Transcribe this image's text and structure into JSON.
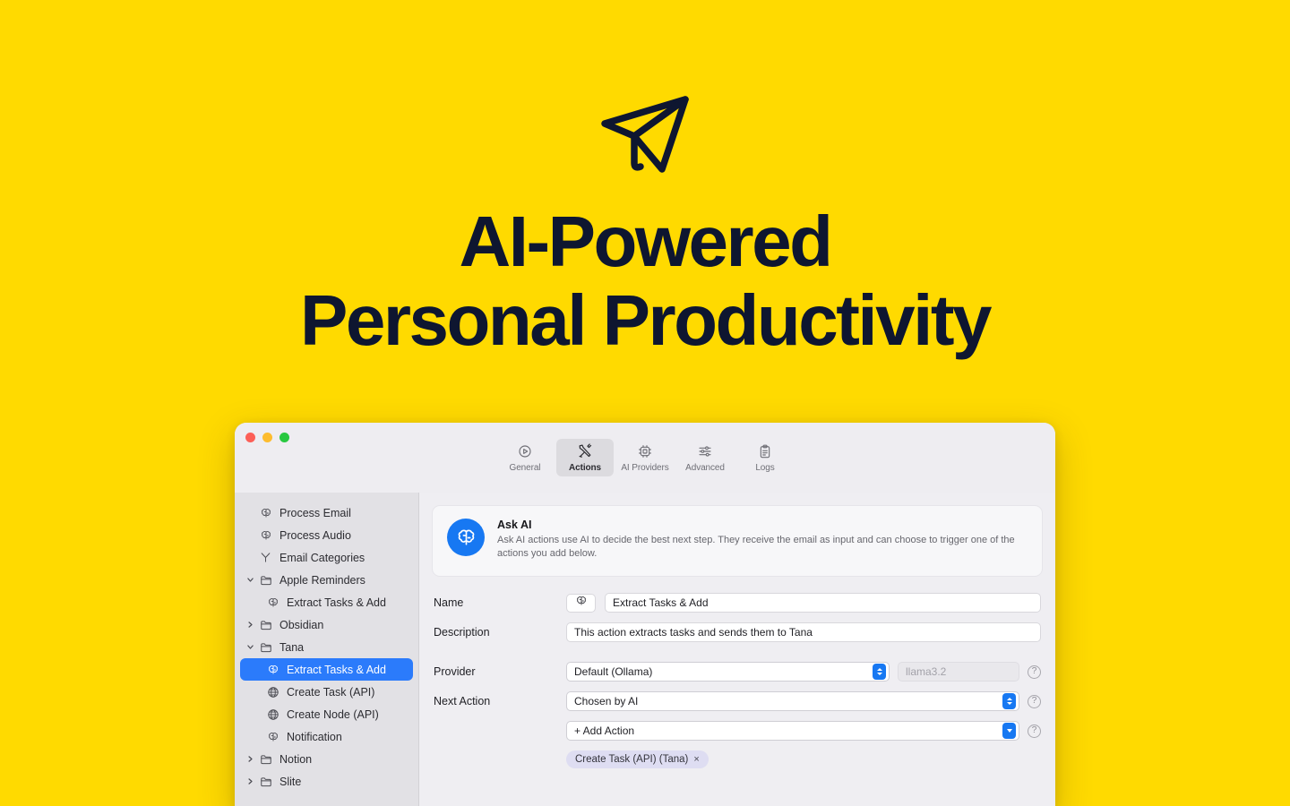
{
  "hero": {
    "logo_icon": "paper-plane-send-icon",
    "title_line1": "AI-Powered",
    "title_line2": "Personal Productivity",
    "background_color": "#FFDA00",
    "text_color": "#0E1630"
  },
  "window": {
    "traffic_lights": [
      "close",
      "minimize",
      "zoom"
    ],
    "accent_color": "#1778F2",
    "selection_color": "#2B7BFB",
    "tabs": [
      {
        "label": "General",
        "icon": "play-circle-icon",
        "active": false
      },
      {
        "label": "Actions",
        "icon": "tools-icon",
        "active": true
      },
      {
        "label": "AI Providers",
        "icon": "chip-icon",
        "active": false
      },
      {
        "label": "Advanced",
        "icon": "sliders-icon",
        "active": false
      },
      {
        "label": "Logs",
        "icon": "clipboard-icon",
        "active": false
      }
    ]
  },
  "sidebar": {
    "items": [
      {
        "label": "Process Email",
        "icon": "brain-icon",
        "indent": 0,
        "chevron": "none",
        "selected": false
      },
      {
        "label": "Process Audio",
        "icon": "brain-icon",
        "indent": 0,
        "chevron": "none",
        "selected": false
      },
      {
        "label": "Email Categories",
        "icon": "branch-icon",
        "indent": 0,
        "chevron": "none",
        "selected": false
      },
      {
        "label": "Apple Reminders",
        "icon": "folder-icon",
        "indent": 0,
        "chevron": "expanded",
        "selected": false
      },
      {
        "label": "Extract Tasks & Add",
        "icon": "brain-icon",
        "indent": 1,
        "chevron": "none",
        "selected": false
      },
      {
        "label": "Obsidian",
        "icon": "folder-icon",
        "indent": 0,
        "chevron": "collapsed",
        "selected": false
      },
      {
        "label": "Tana",
        "icon": "folder-icon",
        "indent": 0,
        "chevron": "expanded",
        "selected": false
      },
      {
        "label": "Extract Tasks & Add",
        "icon": "brain-icon",
        "indent": 1,
        "chevron": "none",
        "selected": true
      },
      {
        "label": "Create Task (API)",
        "icon": "globe-icon",
        "indent": 1,
        "chevron": "none",
        "selected": false
      },
      {
        "label": "Create Node (API)",
        "icon": "globe-icon",
        "indent": 1,
        "chevron": "none",
        "selected": false
      },
      {
        "label": "Notification",
        "icon": "brain-icon",
        "indent": 1,
        "chevron": "none",
        "selected": false
      },
      {
        "label": "Notion",
        "icon": "folder-icon",
        "indent": 0,
        "chevron": "collapsed",
        "selected": false
      },
      {
        "label": "Slite",
        "icon": "folder-icon",
        "indent": 0,
        "chevron": "collapsed",
        "selected": false
      }
    ]
  },
  "main": {
    "info": {
      "icon": "brain-icon",
      "title": "Ask AI",
      "description": "Ask AI actions use AI to decide the best next step. They receive the email as input and can choose to trigger one of the actions you add below."
    },
    "fields": {
      "name_label": "Name",
      "name_icon": "brain-icon",
      "name_value": "Extract Tasks & Add",
      "description_label": "Description",
      "description_value": "This action extracts tasks and sends them to Tana",
      "provider_label": "Provider",
      "provider_value": "Default (Ollama)",
      "model_placeholder": "llama3.2",
      "next_action_label": "Next Action",
      "next_action_value": "Chosen by AI",
      "add_action_label": "+ Add Action",
      "help_icon": "question-mark-circle-icon"
    },
    "chips": [
      {
        "label": "Create Task (API) (Tana)",
        "remove_icon": "close-icon",
        "remove_glyph": "×"
      }
    ]
  }
}
